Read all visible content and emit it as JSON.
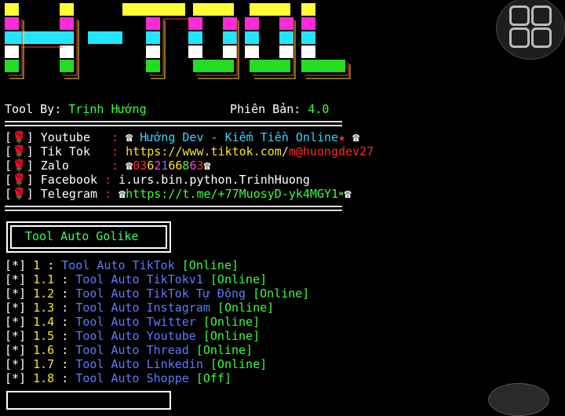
{
  "header": {
    "author_label": "Tool By:",
    "author_name": "Trịnh Hướng",
    "version_label": "Phiên Bản:",
    "version_value": "4.0"
  },
  "contacts": {
    "bracket_open": "[",
    "bracket_close": "]",
    "icon": "🌹",
    "sep": ":",
    "youtube": {
      "label": "Youtube",
      "prefix": "☎",
      "value": "Hướng Dev - Kiếm Tiền Online",
      "suffix": "☎"
    },
    "tiktok": {
      "label": "Tik Tok",
      "value_a": "https://www.tiktok.com/",
      "value_b": "m@huongdev27"
    },
    "zalo": {
      "label": "Zalo",
      "digits": [
        "0",
        "3",
        "6",
        "2",
        "1",
        "6",
        "6",
        "8",
        "6",
        "3"
      ],
      "prefix": "☎",
      "suffix": "☎"
    },
    "facebook": {
      "label": "Facebook",
      "value": "i.urs.bin.python.TrinhHuong"
    },
    "telegram": {
      "label": "Telegram",
      "prefix": "☎",
      "value": "https://t.me/+77MuosyD-yk4MGY1",
      "suffix": "☎"
    }
  },
  "box_title": "Tool Auto Golike",
  "menu": {
    "star": "[*]",
    "sep": ":",
    "items": [
      {
        "num": "1",
        "label": "Tool Auto TikTok",
        "status": "[Online]"
      },
      {
        "num": "1.1",
        "label": "Tool Auto TikTokv1",
        "status": "[Online]"
      },
      {
        "num": "1.2",
        "label": "Tool Auto TikTok Tự Động",
        "status": "[Online]"
      },
      {
        "num": "1.3",
        "label": "Tool Auto Instagram",
        "status": "[Online]"
      },
      {
        "num": "1.4",
        "label": "Tool Auto Twitter",
        "status": "[Online]"
      },
      {
        "num": "1.5",
        "label": "Tool Auto Youtube",
        "status": "[Online]"
      },
      {
        "num": "1.6",
        "label": "Tool Auto Thread",
        "status": "[Online]"
      },
      {
        "num": "1.7",
        "label": "Tool Auto Linkedin",
        "status": "[Online]"
      },
      {
        "num": "1.8",
        "label": "Tool Auto Shoppe",
        "status": "[Off]"
      }
    ]
  },
  "colors": {
    "green": "#3cff3c",
    "blue": "#5b7bff",
    "yellow": "#ffe12c",
    "red": "#ff2b2b",
    "cyan": "#36d4ff"
  },
  "icons": {
    "grid_button": "grid-icon",
    "avatar": "user-avatar-icon",
    "logo": "h-tool-logo"
  }
}
